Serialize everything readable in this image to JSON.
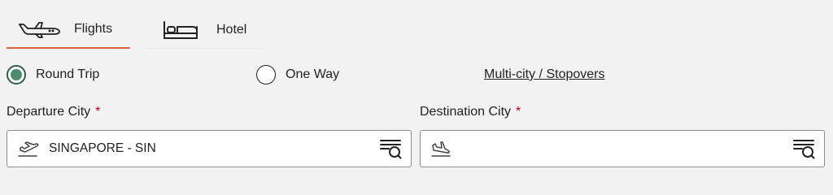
{
  "tabs": [
    {
      "label": "Flights",
      "icon": "airplane-icon",
      "active": true
    },
    {
      "label": "Hotel",
      "icon": "bed-icon",
      "active": false
    }
  ],
  "trip_type": {
    "options": [
      {
        "label": "Round Trip",
        "selected": true
      },
      {
        "label": "One Way",
        "selected": false
      }
    ],
    "multi_city_link": "Multi-city / Stopovers"
  },
  "departure": {
    "label": "Departure City",
    "required_marker": "*",
    "value": "SINGAPORE - SIN",
    "icon": "takeoff-icon",
    "search_icon": "list-search-icon"
  },
  "destination": {
    "label": "Destination City",
    "required_marker": "*",
    "value": "",
    "icon": "landing-icon",
    "search_icon": "list-search-icon"
  },
  "colors": {
    "accent_underline": "#d9643a",
    "radio_selected": "#4d8b6e",
    "required": "#d0021b",
    "background": "#f2f2f2"
  }
}
